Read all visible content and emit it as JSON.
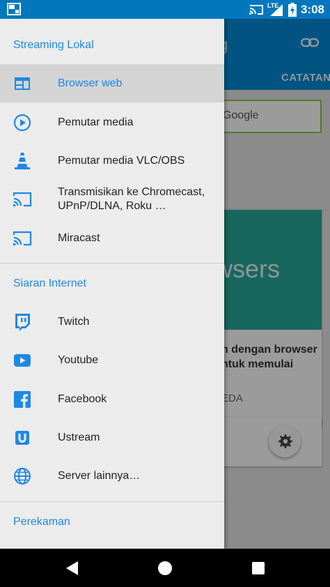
{
  "status_bar": {
    "time": "3:08",
    "network": "LTE",
    "battery_level": "charging",
    "icons": [
      "screen-mirror-icon",
      "cast-icon",
      "signal-icon",
      "battery-icon"
    ]
  },
  "background_app": {
    "title_fragment": "g",
    "tab_fragment": "CATATAN",
    "search_placeholder": "Google",
    "card_banner_fragment": "wsers",
    "card_text_fragment": "n dengan browser ntuk memulai",
    "card_action_fragment": "EDA"
  },
  "drawer": {
    "sections": [
      {
        "header": "Streaming Lokal",
        "items": [
          {
            "label": "Browser web",
            "icon": "browser-icon",
            "selected": true
          },
          {
            "label": "Pemutar media",
            "icon": "play-circle-icon",
            "selected": false
          },
          {
            "label": "Pemutar media VLC/OBS",
            "icon": "vlc-cone-icon",
            "selected": false
          },
          {
            "label": "Transmisikan ke Chromecast, UPnP/DLNA, Roku …",
            "icon": "cast-icon",
            "selected": false
          },
          {
            "label": "Miracast",
            "icon": "cast-icon",
            "selected": false
          }
        ]
      },
      {
        "header": "Siaran Internet",
        "items": [
          {
            "label": "Twitch",
            "icon": "twitch-icon",
            "selected": false
          },
          {
            "label": "Youtube",
            "icon": "youtube-icon",
            "selected": false
          },
          {
            "label": "Facebook",
            "icon": "facebook-icon",
            "selected": false
          },
          {
            "label": "Ustream",
            "icon": "ustream-icon",
            "selected": false
          },
          {
            "label": "Server lainnya…",
            "icon": "globe-icon",
            "selected": false
          }
        ]
      },
      {
        "header": "Perekaman",
        "items": []
      }
    ]
  },
  "colors": {
    "accent": "#1e88e5",
    "status_bar": "#0277bd",
    "app_bar": "#0288d1",
    "drawer_bg": "#ececec",
    "selected_bg": "#d4d4d4"
  },
  "nav_bar": {
    "buttons": [
      "back-icon",
      "home-icon",
      "recents-icon"
    ]
  }
}
